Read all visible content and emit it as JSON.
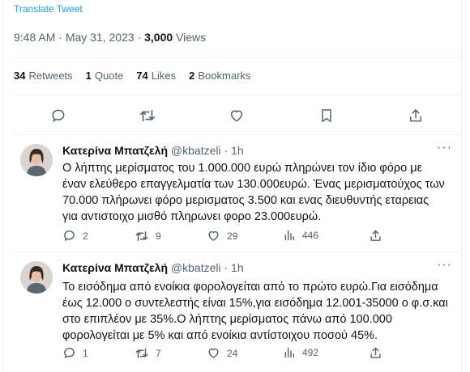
{
  "tweet": {
    "translate_label": "Translate Tweet",
    "time": "9:48 AM",
    "date": "May 31, 2023",
    "views_count": "3,000",
    "views_label": "Views",
    "retweets_count": "34",
    "retweets_label": "Retweets",
    "quotes_count": "1",
    "quotes_label": "Quote",
    "likes_count": "74",
    "likes_label": "Likes",
    "bookmarks_count": "2",
    "bookmarks_label": "Bookmarks"
  },
  "replies": [
    {
      "name": "Κατερίνα Μπατζελή",
      "handle": "@kbatzeli",
      "time": "1h",
      "lines": [
        "Ο λήπτης μερίσματος του 1.000.000 ευρώ πληρώνει τον ίδιο φόρο με",
        "έναν ελεύθερο επαγγελματία των 130.000ευρώ. Ένας μερισματούχος των",
        "70.000 πλήρωνει φόρο μερισματος 3.500 και ενας διευθυντής εταρειας",
        "για αντιστοιχο μισθό πληρωνει φορο 23.000ευρώ."
      ],
      "replies": "2",
      "retweets": "9",
      "likes": "29",
      "views": "446"
    },
    {
      "name": "Κατερίνα Μπατζελή",
      "handle": "@kbatzeli",
      "time": "1h",
      "lines": [
        "Το εισόδημα από ενοίκια φορολογείται από το πρώτο ευρώ.Για εισόδημα",
        "έως 12.000 ο συντελεστής είναι 15%,για εισόδημα 12.001-35000 ο φ.σ.και",
        "στο επιπλέον με  35%.Ο λήπτης μερίσματος πάνω από 100.000",
        "φορολογείται με 5% και από ενοίκια αντίστοιχου ποσού 45%."
      ],
      "replies": "1",
      "retweets": "7",
      "likes": "24",
      "views": "492"
    }
  ],
  "icons": {
    "reply": "reply-icon",
    "retweet": "retweet-icon",
    "like": "heart-icon",
    "bookmark": "bookmark-icon",
    "share": "share-icon",
    "views": "analytics-icon",
    "more": "more-icon"
  },
  "colors": {
    "link": "#1d9bf0",
    "secondary_text": "#536471",
    "divider": "#eff3f4"
  }
}
